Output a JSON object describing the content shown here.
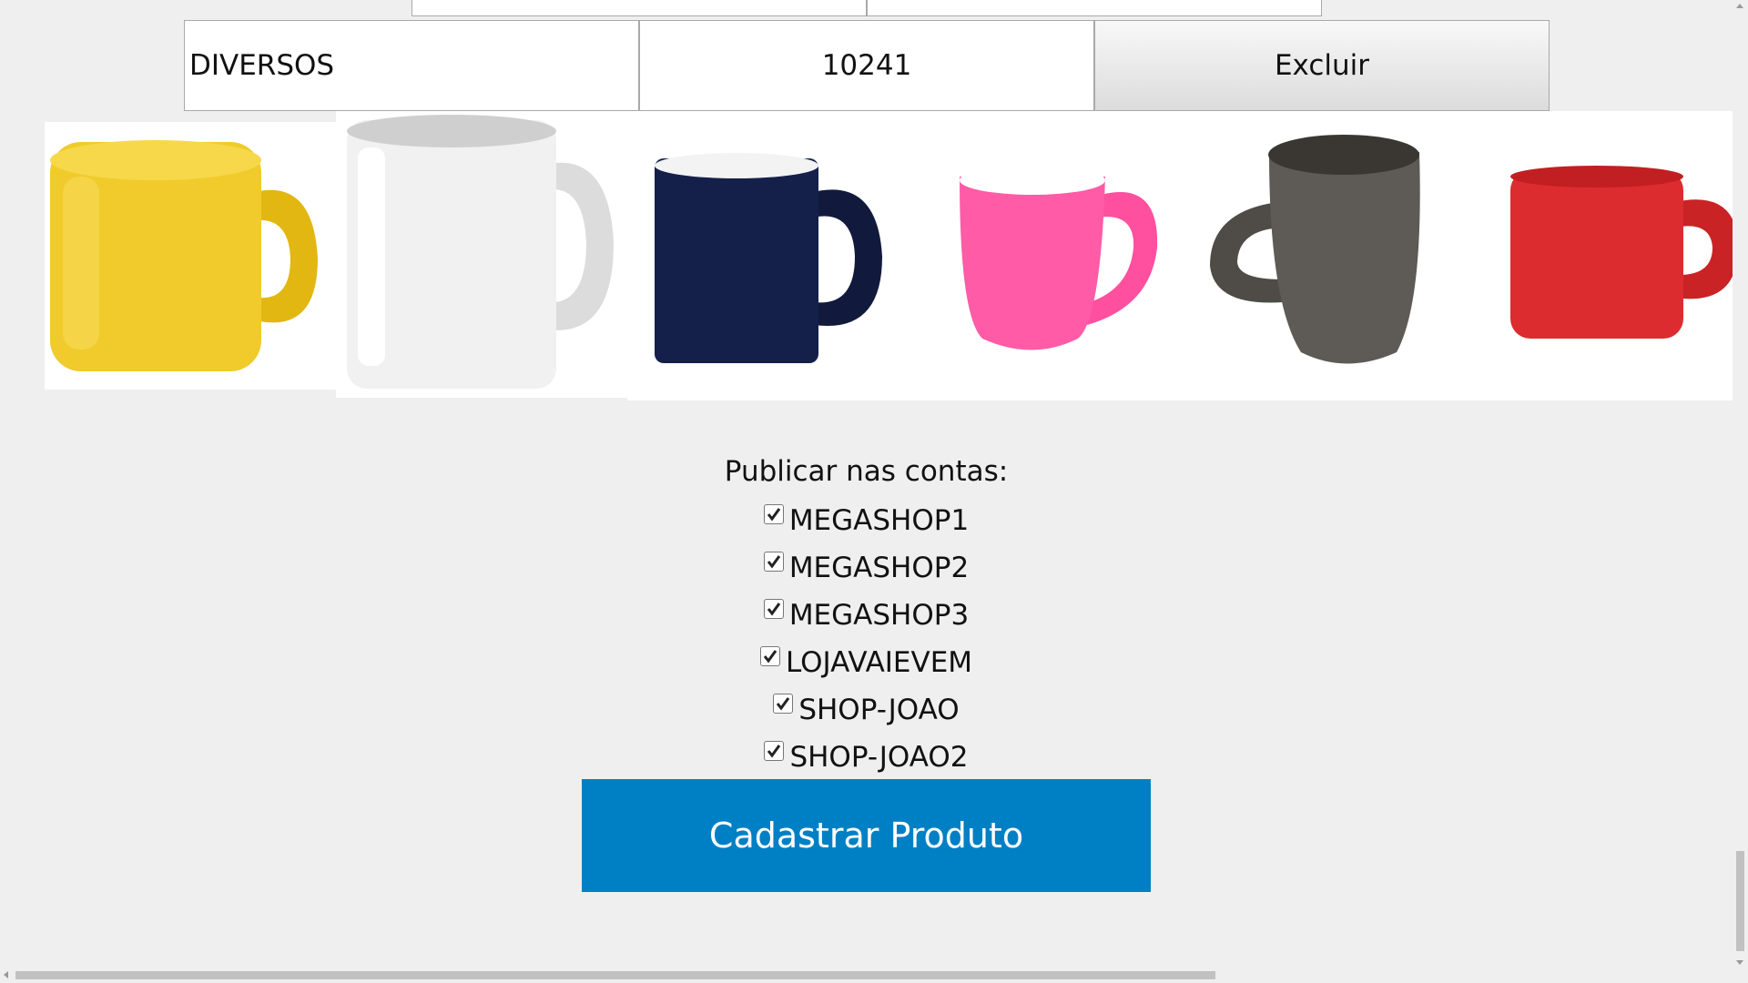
{
  "table_row": {
    "category": "DIVERSOS",
    "code": "10241",
    "delete_label": "Excluir"
  },
  "images": [
    {
      "name": "mug-yellow-image",
      "color": "#f2cd2a"
    },
    {
      "name": "mug-white-image",
      "color": "#ededed"
    },
    {
      "name": "mug-navy-image",
      "color": "#15204a"
    },
    {
      "name": "mug-pink-image",
      "color": "#ff5ba6"
    },
    {
      "name": "mug-gray-image",
      "color": "#5e5a55"
    },
    {
      "name": "mug-red-image",
      "color": "#dc2c2f"
    }
  ],
  "publish": {
    "title": "Publicar nas contas:",
    "accounts": [
      {
        "label": "MEGASHOP1",
        "checked": true
      },
      {
        "label": "MEGASHOP2",
        "checked": true
      },
      {
        "label": "MEGASHOP3",
        "checked": true
      },
      {
        "label": "LOJAVAIEVEM",
        "checked": true
      },
      {
        "label": "SHOP-JOAO",
        "checked": true
      },
      {
        "label": "SHOP-JOAO2",
        "checked": true
      }
    ]
  },
  "submit_label": "Cadastrar Produto",
  "colors": {
    "primary_button": "#0080c4",
    "background": "#efefef"
  }
}
